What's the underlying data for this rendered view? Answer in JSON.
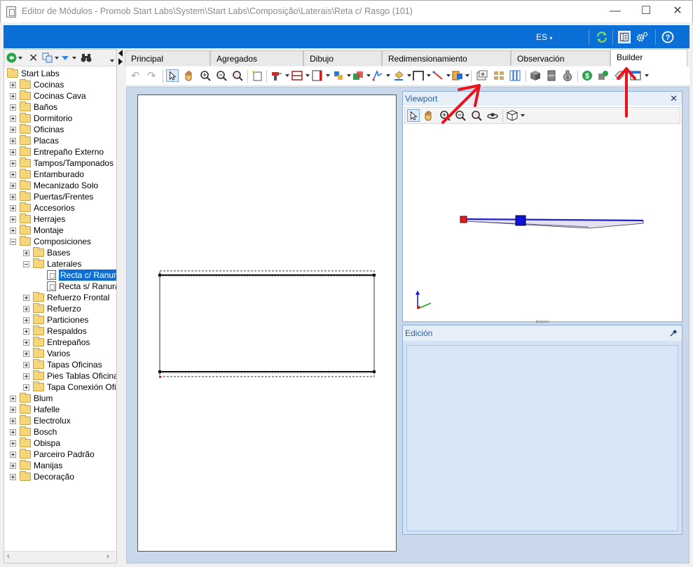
{
  "window": {
    "title": "Editor de Módulos - Promob Start Labs\\System\\Start Labs\\Composição\\Laterais\\Reta c/ Rasgo (101)",
    "minimize": "—",
    "maximize": "☐",
    "close": "✕"
  },
  "band": {
    "language": "ES",
    "icons": [
      "refresh-icon",
      "panel-view-icon",
      "settings-icon",
      "help-icon"
    ],
    "accent": "#0a6fd6"
  },
  "tree": {
    "root": "Start Labs",
    "items": [
      {
        "label": "Cocinas",
        "level": 1
      },
      {
        "label": "Cocinas Cava",
        "level": 1
      },
      {
        "label": "Baños",
        "level": 1
      },
      {
        "label": "Dormitorio",
        "level": 1
      },
      {
        "label": "Oficinas",
        "level": 1
      },
      {
        "label": "Placas",
        "level": 1
      },
      {
        "label": "Entrepaño Externo",
        "level": 1
      },
      {
        "label": "Tampos/Tamponados",
        "level": 1
      },
      {
        "label": "Entamburado",
        "level": 1
      },
      {
        "label": "Mecanizado Solo",
        "level": 1
      },
      {
        "label": "Puertas/Frentes",
        "level": 1
      },
      {
        "label": "Accesorios",
        "level": 1
      },
      {
        "label": "Herrajes",
        "level": 1
      },
      {
        "label": "Montaje",
        "level": 1
      },
      {
        "label": "Composiciones",
        "level": 1,
        "expanded": true
      },
      {
        "label": "Bases",
        "level": 2
      },
      {
        "label": "Laterales",
        "level": 2,
        "expanded": true
      },
      {
        "label": "Recta c/ Ranura",
        "level": 3,
        "doc": true,
        "selected": true
      },
      {
        "label": "Recta s/ Ranura",
        "level": 3,
        "doc": true
      },
      {
        "label": "Refuerzo Frontal",
        "level": 2
      },
      {
        "label": "Refuerzo",
        "level": 2
      },
      {
        "label": "Particiones",
        "level": 2
      },
      {
        "label": "Respaldos",
        "level": 2
      },
      {
        "label": "Entrepaños",
        "level": 2
      },
      {
        "label": "Varios",
        "level": 2
      },
      {
        "label": "Tapas Oficinas",
        "level": 2
      },
      {
        "label": "Pies Tablas Oficina",
        "level": 2
      },
      {
        "label": "Tapa Conexión Ofic",
        "level": 2
      },
      {
        "label": "Blum",
        "level": 1
      },
      {
        "label": "Hafelle",
        "level": 1
      },
      {
        "label": "Electrolux",
        "level": 1
      },
      {
        "label": "Bosch",
        "level": 1
      },
      {
        "label": "Obispa",
        "level": 1
      },
      {
        "label": "Parceiro Padrão",
        "level": 1
      },
      {
        "label": "Manijas",
        "level": 1
      },
      {
        "label": "Decoração",
        "level": 1
      }
    ]
  },
  "tabs": [
    {
      "label": "Principal"
    },
    {
      "label": "Agregados"
    },
    {
      "label": "Dibujo"
    },
    {
      "label": "Redimensionamiento"
    },
    {
      "label": "Observación"
    },
    {
      "label": "Builder",
      "active": true
    }
  ],
  "viewport": {
    "title": "Viewport",
    "close": "✕"
  },
  "edicion": {
    "title": "Edición"
  },
  "annotations": {
    "arrow_color": "#e8141c"
  }
}
